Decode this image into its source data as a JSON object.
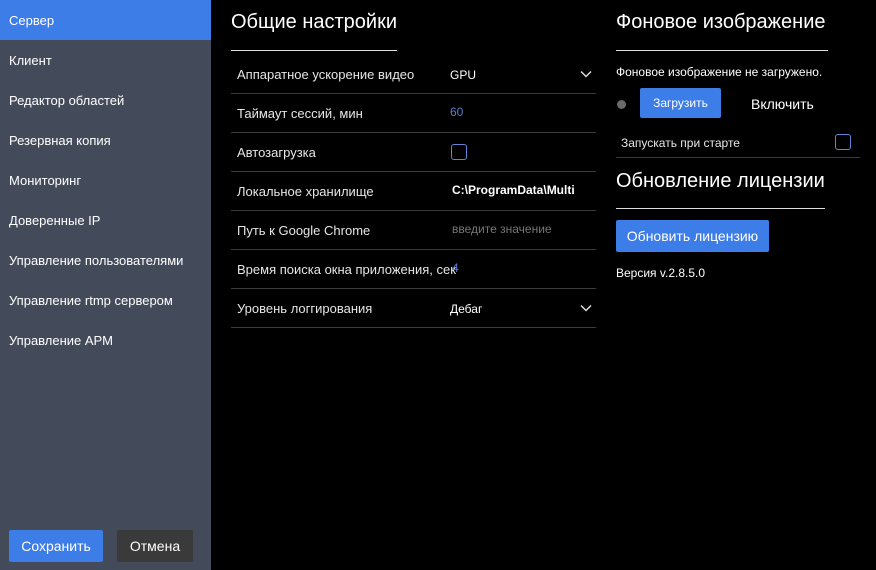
{
  "sidebar": {
    "items": [
      {
        "label": "Сервер",
        "active": true
      },
      {
        "label": "Клиент"
      },
      {
        "label": "Редактор областей"
      },
      {
        "label": "Резервная копия"
      },
      {
        "label": "Мониторинг"
      },
      {
        "label": "Доверенные IP"
      },
      {
        "label": "Управление пользователями"
      },
      {
        "label": "Управление rtmp сервером"
      },
      {
        "label": "Управление АРМ"
      }
    ],
    "save_label": "Сохранить",
    "cancel_label": "Отмена"
  },
  "general": {
    "title": "Общие настройки",
    "rows": [
      {
        "label": "Аппаратное ускорение видео",
        "value": "GPU",
        "type": "select"
      },
      {
        "label": "Таймаут сессий, мин",
        "value": "60",
        "type": "number"
      },
      {
        "label": "Автозагрузка",
        "value": "",
        "type": "checkbox",
        "checked": false
      },
      {
        "label": "Локальное хранилище",
        "value": "C:\\ProgramData\\Multi",
        "type": "text"
      },
      {
        "label": "Путь к Google Chrome",
        "placeholder": "введите значение",
        "type": "text-placeholder"
      },
      {
        "label": "Время поиска окна приложения, сек",
        "value": "4",
        "type": "number"
      },
      {
        "label": "Уровень логгирования",
        "value": "Дебаг",
        "type": "select"
      }
    ]
  },
  "background": {
    "title": "Фоновое изображение",
    "status": "Фоновое изображение не загружено.",
    "upload_label": "Загрузить",
    "enable_label": "Включить",
    "autostart_label": "Запускать при старте",
    "autostart_checked": false
  },
  "license": {
    "title": "Обновление лицензии",
    "update_label": "Обновить лицензию",
    "version": "Версия v.2.8.5.0"
  },
  "colors": {
    "accent": "#3d7de8",
    "sidebar_bg": "#434b5b",
    "main_bg": "#000000"
  }
}
